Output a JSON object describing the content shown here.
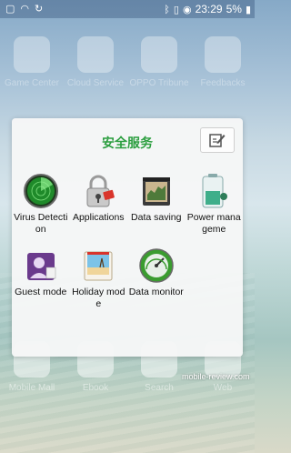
{
  "statusbar": {
    "time": "23:29",
    "battery": "5%"
  },
  "home": {
    "top_apps": [
      {
        "label": "Game Center"
      },
      {
        "label": "Cloud Service"
      },
      {
        "label": "OPPO Tribune"
      },
      {
        "label": "Feedbacks"
      }
    ],
    "bottom_apps": [
      {
        "label": "Mobile Mall"
      },
      {
        "label": "Ebook"
      },
      {
        "label": "Search"
      },
      {
        "label": "Web"
      }
    ],
    "watermark": "mobile-review.com"
  },
  "folder": {
    "title": "安全服务",
    "apps": [
      {
        "label": "Virus Detection",
        "icon": "radar-icon"
      },
      {
        "label": "Applications",
        "icon": "padlock-icon"
      },
      {
        "label": "Data saving",
        "icon": "data-saving-icon"
      },
      {
        "label": "Power manageme",
        "icon": "battery-icon"
      },
      {
        "label": "Guest mode",
        "icon": "guest-icon"
      },
      {
        "label": "Holiday mode",
        "icon": "holiday-icon"
      },
      {
        "label": "Data monitor",
        "icon": "gauge-icon"
      }
    ]
  }
}
